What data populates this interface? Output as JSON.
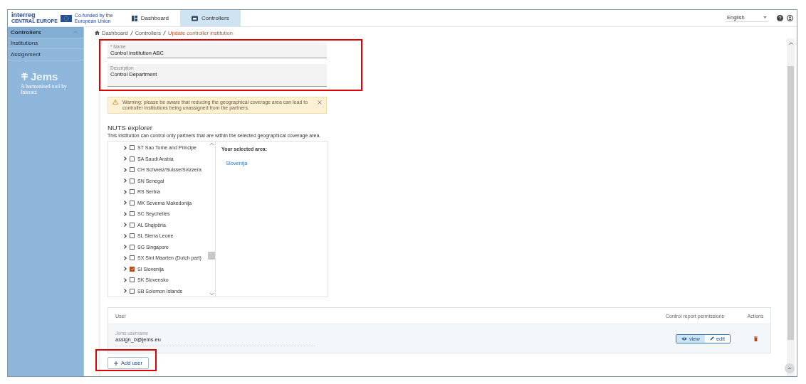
{
  "header": {
    "logo": {
      "brand": "interreg",
      "region": "CENTRAL EUROPE",
      "cofund": "Co-funded by the European Union"
    },
    "tabs": [
      {
        "label": "Dashboard",
        "selected": false
      },
      {
        "label": "Controllers",
        "selected": true
      }
    ],
    "language": "English"
  },
  "sidebar": {
    "items": [
      {
        "label": "Controllers",
        "selected": true,
        "expanded": true
      },
      {
        "label": "Institutions",
        "selected": false
      },
      {
        "label": "Assignment",
        "selected": false
      }
    ],
    "brand": {
      "name": "Jems",
      "tagline": "A harmonised tool by Interact"
    }
  },
  "breadcrumb": [
    "Dashboard",
    "Controllers",
    "Update controller institution"
  ],
  "form": {
    "fields": [
      {
        "label": "* Name",
        "value": "Control institution ABC",
        "kind": "input"
      },
      {
        "label": "Description",
        "value": "Control Department",
        "kind": "textarea"
      }
    ],
    "warning": "Warning: please be aware that reducing the geographical coverage area can lead to controller institutions being unassigned from the partners."
  },
  "nuts": {
    "title": "NUTS explorer",
    "subtitle": "This institution can control only partners that are within the selected geographical coverage area.",
    "items": [
      {
        "label": "ST Sao Tome and Principe",
        "checked": false
      },
      {
        "label": "SA Saudi Arabia",
        "checked": false
      },
      {
        "label": "CH Schweiz/Suisse/Svizzera",
        "checked": false
      },
      {
        "label": "SN Senegal",
        "checked": false
      },
      {
        "label": "RS Serbia",
        "checked": false
      },
      {
        "label": "MK Severna Makedonija",
        "checked": false
      },
      {
        "label": "SC Seychelles",
        "checked": false
      },
      {
        "label": "AL Shqipëria",
        "checked": false
      },
      {
        "label": "SL Sierra Leone",
        "checked": false
      },
      {
        "label": "SG Singapore",
        "checked": false
      },
      {
        "label": "SX Sint Maarten (Dutch part)",
        "checked": false
      },
      {
        "label": "SI Slovenija",
        "checked": true
      },
      {
        "label": "SK Slovensko",
        "checked": false
      },
      {
        "label": "SB Solomon Islands",
        "checked": false
      }
    ],
    "selected_title": "Your selected area:",
    "selected_areas": [
      "Slovenija"
    ]
  },
  "users": {
    "columns": [
      "User",
      "Control report permissions",
      "Actions"
    ],
    "rows": [
      {
        "field_label": "Jems username",
        "value": "assign_0@jems.eu",
        "permissions": [
          {
            "label": "view",
            "selected": true
          },
          {
            "label": "edit",
            "selected": false
          }
        ]
      }
    ],
    "add_button": "Add user"
  }
}
